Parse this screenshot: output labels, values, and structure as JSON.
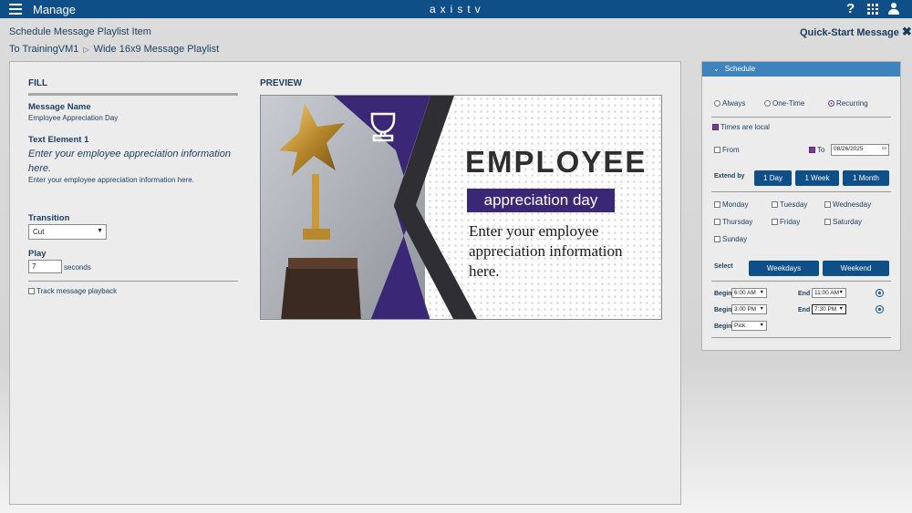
{
  "topbar": {
    "menu_icon": "hamburger-icon",
    "title": "Manage",
    "logo": "axistv",
    "help_label": "?",
    "apps_icon": "grid-icon",
    "user_icon": "user-icon"
  },
  "header": {
    "page_title": "Schedule Message Playlist Item",
    "breadcrumb": [
      "To TrainingVM1",
      "Wide 16x9 Message Playlist"
    ],
    "quick_start": "Quick-Start Message"
  },
  "fill": {
    "heading": "FILL",
    "message_name_label": "Message Name",
    "message_name_value": "Employee Appreciation Day",
    "text_element_label": "Text Element 1",
    "text_element_italic": "Enter your employee appreciation information here.",
    "text_element_value": "Enter your employee appreciation information here.",
    "transition_label": "Transition",
    "transition_value": "Cut",
    "play_label": "Play",
    "play_value": "7",
    "seconds_label": "seconds",
    "track_label": "Track message playback",
    "track_checked": false
  },
  "preview": {
    "heading": "PREVIEW",
    "headline": "EMPLOYEE",
    "badge": "appreciation day",
    "body": "Enter your employee appreciation information here.",
    "accent_color": "#3a2877"
  },
  "schedule": {
    "title": "Schedule",
    "modes": [
      {
        "label": "Always",
        "selected": false
      },
      {
        "label": "One-Time",
        "selected": false
      },
      {
        "label": "Recurring",
        "selected": true
      }
    ],
    "times_local_label": "Times are local",
    "times_local_checked": true,
    "from_label": "From",
    "from_checked": false,
    "to_label": "To",
    "to_checked": true,
    "to_date": "08/26/2025",
    "extend_label": "Extend by",
    "extend_buttons": [
      "1 Day",
      "1 Week",
      "1 Month"
    ],
    "days": [
      "Monday",
      "Tuesday",
      "Wednesday",
      "Thursday",
      "Friday",
      "Saturday",
      "Sunday"
    ],
    "select_label": "Select",
    "select_buttons": [
      "Weekdays",
      "Weekend"
    ],
    "begin_label": "Begin",
    "end_label": "End",
    "time_rows": [
      {
        "begin": "6:00 AM",
        "end": "11:00 AM"
      },
      {
        "begin": "3:00 PM",
        "end": "7:30 PM"
      },
      {
        "begin": "Pick"
      }
    ],
    "accent_color": "#0d4f86"
  }
}
